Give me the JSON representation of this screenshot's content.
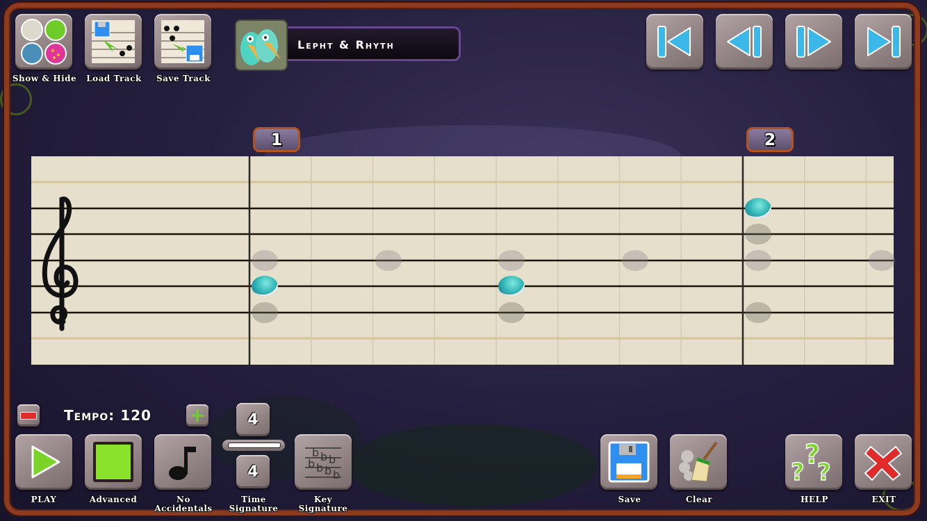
{
  "top_toolbar": {
    "show_hide_label": "Show & Hide",
    "load_track_label": "Load Track",
    "save_track_label": "Save Track"
  },
  "monster": {
    "name": "Lepht & Rhyth"
  },
  "nav_buttons": [
    "skip-to-start",
    "previous-bar",
    "next-bar",
    "skip-to-end"
  ],
  "staff": {
    "clef": "treble",
    "bars": [
      {
        "number": "1"
      },
      {
        "number": "2"
      }
    ],
    "notes": [
      {
        "bar": 1,
        "beat": 1,
        "pitch_line": "G4",
        "state": "active"
      },
      {
        "bar": 1,
        "beat": 1,
        "pitch_line": "B4",
        "state": "ghost"
      },
      {
        "bar": 1,
        "beat": 1,
        "pitch_line": "E4",
        "state": "ghost"
      },
      {
        "bar": 1,
        "beat": 3,
        "pitch_line": "B4",
        "state": "ghost"
      },
      {
        "bar": 1,
        "beat": 5,
        "pitch_line": "G4",
        "state": "active"
      },
      {
        "bar": 1,
        "beat": 5,
        "pitch_line": "B4",
        "state": "ghost"
      },
      {
        "bar": 1,
        "beat": 5,
        "pitch_line": "E4",
        "state": "ghost"
      },
      {
        "bar": 1,
        "beat": 7,
        "pitch_line": "B4",
        "state": "ghost"
      },
      {
        "bar": 2,
        "beat": 1,
        "pitch_line": "F5",
        "state": "active"
      },
      {
        "bar": 2,
        "beat": 1,
        "pitch_line": "D5",
        "state": "ghost"
      },
      {
        "bar": 2,
        "beat": 1,
        "pitch_line": "B4",
        "state": "ghost"
      },
      {
        "bar": 2,
        "beat": 1,
        "pitch_line": "E4",
        "state": "ghost"
      },
      {
        "bar": 2,
        "beat": 3,
        "pitch_line": "B4",
        "state": "ghost"
      }
    ]
  },
  "tempo": {
    "label": "Tempo:",
    "value": "120"
  },
  "time_signature": {
    "numerator": "4",
    "denominator": "4",
    "label": "Time Signature"
  },
  "bottom_toolbar": {
    "play_label": "PLAY",
    "advanced_label": "Advanced",
    "no_accidentals_label": "No Accidentals",
    "key_signature_label": "Key Signature",
    "save_label": "Save",
    "clear_label": "Clear",
    "help_label": "HELP",
    "exit_label": "EXIT"
  },
  "colors": {
    "frame": "#8e3a1f",
    "staff_paper": "#e6dfcc",
    "note_active": "#2fb4b4",
    "bar_badge_border": "#b4531f",
    "title_border": "#6a4690"
  }
}
